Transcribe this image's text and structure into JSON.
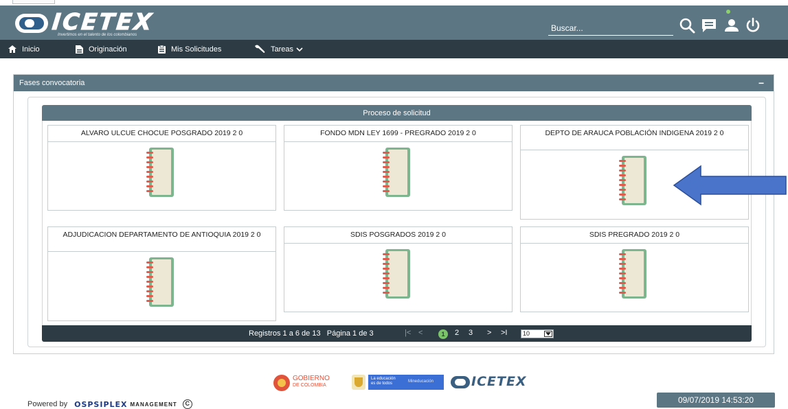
{
  "app": {
    "brand_name": "ICETEX",
    "brand_tagline": "Invertimos en el talento de los colombianos"
  },
  "header": {
    "search_placeholder": "Buscar...",
    "icons": [
      "search-icon",
      "messages-icon",
      "user-icon",
      "power-icon"
    ]
  },
  "nav": {
    "items": [
      {
        "label": "Inicio",
        "icon": "home-icon"
      },
      {
        "label": "Originación",
        "icon": "document-icon"
      },
      {
        "label": "Mis Solicitudes",
        "icon": "clipboard-icon"
      },
      {
        "label": "Tareas",
        "icon": "wrench-icon",
        "has_dropdown": true
      }
    ]
  },
  "panel": {
    "title": "Fases convocatoria",
    "collapse_symbol": "−"
  },
  "process": {
    "title": "Proceso de solicitud",
    "cards": [
      {
        "title": "ALVARO ULCUE CHOCUE POSGRADO 2019 2 0",
        "icon": "notebook-icon"
      },
      {
        "title": "FONDO MDN LEY 1699 - PREGRADO 2019 2 0",
        "icon": "notebook-icon"
      },
      {
        "title": "DEPTO DE ARAUCA POBLACIÓN INDIGENA 2019 2 0",
        "icon": "notebook-icon"
      },
      {
        "title": "ADJUDICACION DEPARTAMENTO DE ANTIOQUIA 2019 2 0",
        "icon": "notebook-icon"
      },
      {
        "title": "SDIS POSGRADOS 2019 2 0",
        "icon": "notebook-icon"
      },
      {
        "title": "SDIS PREGRADO 2019 2 0",
        "icon": "notebook-icon"
      }
    ]
  },
  "pager": {
    "records": "Registros 1 a 6 de 13",
    "page_info": "Página 1 de 3",
    "first": "|<",
    "prev": "<",
    "current_page": "1",
    "pages": [
      "2",
      "3"
    ],
    "next": ">",
    "last": ">I",
    "page_size": "10"
  },
  "footer": {
    "powered_by": "Powered by",
    "provider_name": "OSPSIPLEX",
    "provider_suffix": "MANAGEMENT",
    "copyright_symbol": "C",
    "timestamp": "09/07/2019 14:53:20",
    "logos": {
      "gobierno_line1": "GOBIERNO",
      "gobierno_line2": "DE COLOMBIA",
      "mineducacion_line1": "La educación",
      "mineducacion_line2": "es de todos",
      "mineducacion_label": "Mineducación",
      "icetex_label": "ICETEX"
    }
  },
  "colors": {
    "header_bg": "#5d7683",
    "nav_bg": "#2c3b44",
    "arrow_fill": "#4a74c9",
    "notebook_cover": "#7db58e",
    "notebook_rings": "#e05c4d",
    "active_page": "#7cc46a"
  }
}
